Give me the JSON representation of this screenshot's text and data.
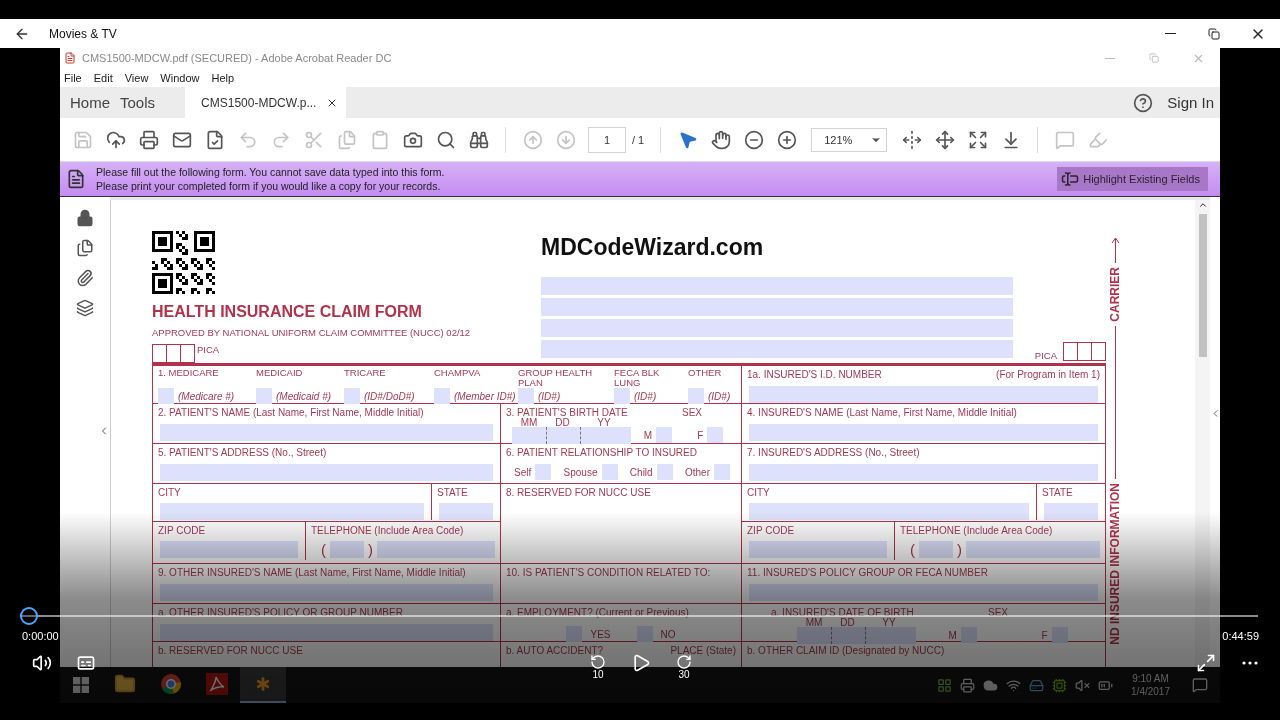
{
  "player": {
    "app_title": "Movies & TV",
    "elapsed": "0:00:00",
    "duration": "0:44:59",
    "progress": {
      "level": 0
    },
    "skip_back": "10",
    "skip_forward": "30"
  },
  "acrobat": {
    "title": "CMS1500-MDCW.pdf (SECURED) - Adobe Acrobat Reader DC",
    "menu": [
      "File",
      "Edit",
      "View",
      "Window",
      "Help"
    ],
    "tabs": [
      {
        "label": "Home",
        "selected": false
      },
      {
        "label": "Tools",
        "selected": false
      },
      {
        "label": "CMS1500-MDCW.p...",
        "selected": true
      }
    ],
    "sign_in": "Sign In",
    "toolbar": [
      {
        "kind": "save",
        "disabled": true
      },
      {
        "kind": "upload",
        "disabled": false
      },
      {
        "kind": "print",
        "disabled": false
      },
      {
        "kind": "mail",
        "disabled": false
      },
      {
        "kind": "certify",
        "disabled": false
      },
      {
        "kind": "undo",
        "disabled": true
      },
      {
        "kind": "redo",
        "disabled": true
      },
      {
        "kind": "cut",
        "disabled": true
      },
      {
        "kind": "copy",
        "disabled": true
      },
      {
        "kind": "paste",
        "disabled": true
      },
      {
        "kind": "snapshot",
        "disabled": false
      },
      {
        "kind": "search",
        "disabled": false
      },
      {
        "kind": "find",
        "disabled": false
      },
      {
        "kind": "separator"
      },
      {
        "kind": "previous",
        "disabled": true
      },
      {
        "kind": "next",
        "disabled": true
      },
      {
        "kind": "page",
        "value": "1",
        "total": "/ 1"
      },
      {
        "kind": "separator"
      },
      {
        "kind": "pointer",
        "disabled": false
      },
      {
        "kind": "hand",
        "disabled": false
      },
      {
        "kind": "zoomout",
        "disabled": false
      },
      {
        "kind": "zoomin",
        "disabled": false
      },
      {
        "kind": "zoom",
        "value": "121%"
      },
      {
        "kind": "fitwidth",
        "disabled": false
      },
      {
        "kind": "fitpage",
        "disabled": false
      },
      {
        "kind": "fullscreen",
        "disabled": false
      },
      {
        "kind": "scroll",
        "disabled": false
      },
      {
        "kind": "separator"
      },
      {
        "kind": "comment",
        "disabled": true
      },
      {
        "kind": "highlight",
        "disabled": true
      }
    ],
    "banner": {
      "lines": [
        "Please fill out the following form. You cannot save data typed into this form.",
        "Please print your completed form if you would like a copy for your records."
      ],
      "button": "Highlight Existing Fields"
    }
  },
  "form": {
    "site": "MDCodeWizard.com",
    "title": "HEALTH INSURANCE CLAIM FORM",
    "approved": "APPROVED BY NATIONAL UNIFORM CLAIM COMMITTEE (NUCC) 02/12",
    "pica_left": "PICA",
    "pica_right": "PICA",
    "carrier_label": "CARRIER",
    "side_label": "ND INSURED INFORMATION",
    "carrier_fields": [
      {
        "kind": "field"
      },
      {
        "kind": "field"
      },
      {
        "kind": "field"
      },
      {
        "kind": "field"
      }
    ],
    "cells": [
      {
        "kind": "insurance",
        "options": [
          {
            "label": "1.  MEDICARE",
            "hint": "(Medicare #)",
            "checked": false
          },
          {
            "label": "MEDICAID",
            "hint": "(Medicaid  #)",
            "checked": false
          },
          {
            "label": "TRICARE",
            "hint": "(ID#/DoD#)",
            "checked": false
          },
          {
            "label": "CHAMPVA",
            "hint": "(Member ID#)",
            "checked": false
          },
          {
            "label": "GROUP HEALTH PLAN",
            "hint": "(ID#)",
            "checked": false
          },
          {
            "label": "FECA BLK LUNG",
            "hint": "(ID#)",
            "checked": false
          },
          {
            "label": "OTHER",
            "hint": "(ID#)",
            "checked": false
          }
        ]
      },
      {
        "kind": "text",
        "label": "1a. INSURED'S I.D. NUMBER",
        "note": "(For Program in Item 1)"
      },
      {
        "kind": "text",
        "label": "2. PATIENT'S NAME (Last Name, First Name, Middle Initial)"
      },
      {
        "kind": "date",
        "label": "3. PATIENT'S BIRTH DATE",
        "units": [
          "MM",
          "DD",
          "YY"
        ],
        "sex_label": "SEX",
        "sexes": [
          {
            "label": "M",
            "checked": false
          },
          {
            "label": "F",
            "checked": false
          }
        ]
      },
      {
        "kind": "text",
        "label": "4. INSURED'S NAME (Last Name, First Name, Middle Initial)"
      },
      {
        "kind": "text",
        "label": "5. PATIENT'S ADDRESS (No., Street)"
      },
      {
        "kind": "choices",
        "label": "6. PATIENT RELATIONSHIP TO INSURED",
        "options": [
          {
            "label": "Self",
            "checked": false
          },
          {
            "label": "Spouse",
            "checked": false
          },
          {
            "label": "Child",
            "checked": false
          },
          {
            "label": "Other",
            "checked": false
          }
        ]
      },
      {
        "kind": "text",
        "label": "7. INSURED'S ADDRESS (No., Street)"
      },
      {
        "kind": "split",
        "parts": [
          {
            "label": "CITY"
          },
          {
            "label": "STATE"
          }
        ]
      },
      {
        "kind": "reserved",
        "label": "8. RESERVED FOR NUCC USE"
      },
      {
        "kind": "split",
        "parts": [
          {
            "label": "CITY"
          },
          {
            "label": "STATE"
          }
        ]
      },
      {
        "kind": "split",
        "parts": [
          {
            "label": "ZIP CODE"
          },
          {
            "label": "TELEPHONE (Include Area Code)",
            "open": "(",
            "close": ")"
          }
        ]
      },
      {
        "kind": "split",
        "parts": [
          {
            "label": "ZIP CODE"
          },
          {
            "label": "TELEPHONE (Include Area Code)",
            "open": "(",
            "close": ")"
          }
        ]
      },
      {
        "kind": "text",
        "label": "9. OTHER INSURED'S NAME (Last Name, First Name, Middle Initial)"
      },
      {
        "kind": "heading",
        "label": "10. IS PATIENT'S CONDITION RELATED TO:"
      },
      {
        "kind": "text",
        "label": "11. INSURED'S POLICY GROUP OR FECA NUMBER"
      },
      {
        "kind": "text",
        "label": "a. OTHER INSURED'S POLICY OR GROUP NUMBER"
      },
      {
        "kind": "yesno",
        "label": "a. EMPLOYMENT? (Current or Previous)",
        "options": [
          {
            "label": "YES",
            "checked": false
          },
          {
            "label": "NO",
            "checked": false
          }
        ]
      },
      {
        "kind": "date",
        "label": "a. INSURED'S DATE OF BIRTH",
        "units": [
          "MM",
          "DD",
          "YY"
        ],
        "sex_label": "SEX",
        "sexes": [
          {
            "label": "M",
            "checked": false
          },
          {
            "label": "F",
            "checked": false
          }
        ]
      },
      {
        "kind": "heading",
        "label": "b. RESERVED FOR NUCC USE"
      },
      {
        "kind": "heading",
        "label": "b. AUTO ACCIDENT?",
        "note": "PLACE (State)"
      },
      {
        "kind": "heading",
        "label": "b. OTHER CLAIM ID (Designated by NUCC)"
      }
    ]
  },
  "taskbar": {
    "apps": [
      {
        "kind": "explorer",
        "selected": false
      },
      {
        "kind": "browser",
        "selected": false
      },
      {
        "kind": "pdf",
        "selected": false
      },
      {
        "kind": "asterisk",
        "selected": true
      }
    ],
    "time": "9:10 AM",
    "date": "1/4/2017"
  }
}
